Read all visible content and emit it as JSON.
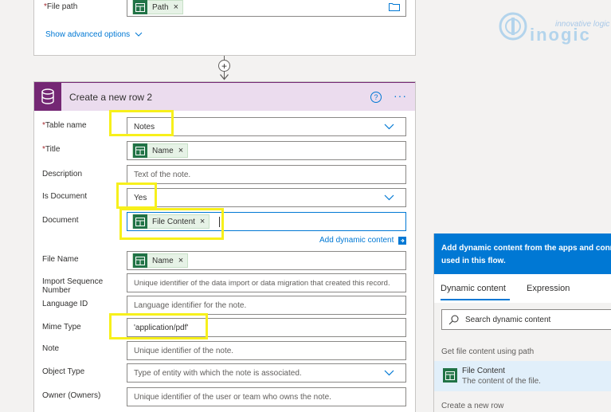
{
  "prev_card": {
    "file_path_label": "File path",
    "file_path_token": "Path",
    "show_advanced": "Show advanced options"
  },
  "card": {
    "title": "Create a new row 2",
    "fields": {
      "table_name": {
        "label": "Table name",
        "value": "Notes"
      },
      "title": {
        "label": "Title",
        "token": "Name"
      },
      "description": {
        "label": "Description",
        "placeholder": "Text of the note."
      },
      "is_document": {
        "label": "Is Document",
        "value": "Yes"
      },
      "document": {
        "label": "Document",
        "token": "File Content"
      },
      "file_name": {
        "label": "File Name",
        "token": "Name"
      },
      "import_seq": {
        "label": "Import Sequence Number",
        "placeholder": "Unique identifier of the data import or data migration that created this record."
      },
      "language_id": {
        "label": "Language ID",
        "placeholder": "Language identifier for the note."
      },
      "mime_type": {
        "label": "Mime Type",
        "value": "'application/pdf'"
      },
      "note": {
        "label": "Note",
        "placeholder": "Unique identifier of the note."
      },
      "object_type": {
        "label": "Object Type",
        "placeholder": "Type of entity with which the note is associated."
      },
      "owner": {
        "label": "Owner (Owners)",
        "placeholder": "Unique identifier of the user or team who owns the note."
      }
    },
    "add_dynamic_content": "Add dynamic content"
  },
  "panel": {
    "header_line1": "Add dynamic content from the apps and conn",
    "header_line2": "used in this flow.",
    "tab_dynamic": "Dynamic content",
    "tab_expression": "Expression",
    "search_placeholder": "Search dynamic content",
    "group1": "Get file content using path",
    "item_title": "File Content",
    "item_desc": "The content of the file.",
    "group2": "Create a new row"
  },
  "logo": {
    "tagline": "innovative logic",
    "name": "inogic"
  },
  "colors": {
    "accent": "#0078d4",
    "dataverse": "#742774",
    "highlight": "#f7f01b",
    "excel_green": "#217346"
  }
}
